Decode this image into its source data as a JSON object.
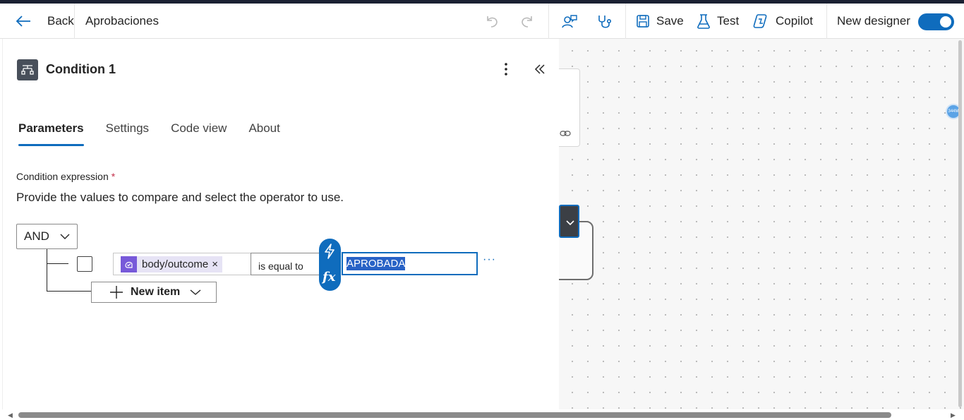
{
  "header": {
    "back_label": "Back",
    "flow_title": "Aprobaciones",
    "save_label": "Save",
    "test_label": "Test",
    "copilot_label": "Copilot",
    "new_designer_label": "New designer",
    "new_designer_on": true
  },
  "panel": {
    "title": "Condition 1",
    "tabs": [
      {
        "label": "Parameters",
        "active": true
      },
      {
        "label": "Settings",
        "active": false
      },
      {
        "label": "Code view",
        "active": false
      },
      {
        "label": "About",
        "active": false
      }
    ],
    "condition_label": "Condition expression",
    "required_mark": "*",
    "description": "Provide the values to compare and select the operator to use.",
    "group_operator": "AND",
    "row": {
      "left_token": "body/outcome",
      "token_remove": "×",
      "operator": "is equal to",
      "right_value": "APROBADA",
      "more": "···"
    },
    "new_item_label": "New item"
  },
  "canvas": {
    "bubble_text": "344M"
  },
  "colors": {
    "accent": "#0f6cbd",
    "token": "#7759d9",
    "top_stripe": "#1b2133"
  }
}
